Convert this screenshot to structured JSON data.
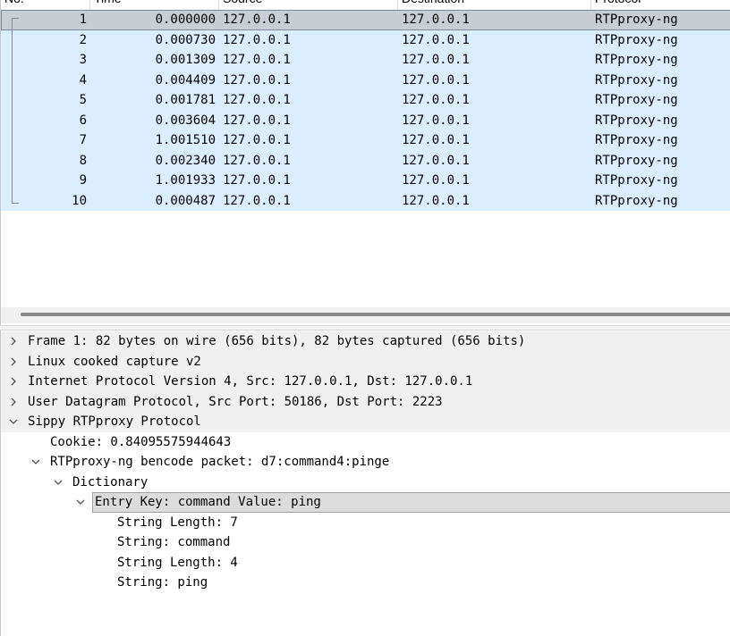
{
  "packet_list": {
    "columns": [
      "No.",
      "Time",
      "Source",
      "Destination",
      "Protocol"
    ],
    "rows": [
      {
        "no": "1",
        "time": "0.000000",
        "source": "127.0.0.1",
        "destination": "127.0.0.1",
        "protocol": "RTPproxy-ng"
      },
      {
        "no": "2",
        "time": "0.000730",
        "source": "127.0.0.1",
        "destination": "127.0.0.1",
        "protocol": "RTPproxy-ng"
      },
      {
        "no": "3",
        "time": "0.001309",
        "source": "127.0.0.1",
        "destination": "127.0.0.1",
        "protocol": "RTPproxy-ng"
      },
      {
        "no": "4",
        "time": "0.004409",
        "source": "127.0.0.1",
        "destination": "127.0.0.1",
        "protocol": "RTPproxy-ng"
      },
      {
        "no": "5",
        "time": "0.001781",
        "source": "127.0.0.1",
        "destination": "127.0.0.1",
        "protocol": "RTPproxy-ng"
      },
      {
        "no": "6",
        "time": "0.003604",
        "source": "127.0.0.1",
        "destination": "127.0.0.1",
        "protocol": "RTPproxy-ng"
      },
      {
        "no": "7",
        "time": "1.001510",
        "source": "127.0.0.1",
        "destination": "127.0.0.1",
        "protocol": "RTPproxy-ng"
      },
      {
        "no": "8",
        "time": "0.002340",
        "source": "127.0.0.1",
        "destination": "127.0.0.1",
        "protocol": "RTPproxy-ng"
      },
      {
        "no": "9",
        "time": "1.001933",
        "source": "127.0.0.1",
        "destination": "127.0.0.1",
        "protocol": "RTPproxy-ng"
      },
      {
        "no": "10",
        "time": "0.000487",
        "source": "127.0.0.1",
        "destination": "127.0.0.1",
        "protocol": "RTPproxy-ng"
      }
    ],
    "selected_row": "1",
    "colors": {
      "row_bg": "#dbeeff",
      "selected_bg": "#c9ced4"
    }
  },
  "details": {
    "frame": "Frame 1: 82 bytes on wire (656 bits), 82 bytes captured (656 bits)",
    "linux_cooked": "Linux cooked capture v2",
    "ipv4": "Internet Protocol Version 4, Src: 127.0.0.1, Dst: 127.0.0.1",
    "udp": "User Datagram Protocol, Src Port: 50186, Dst Port: 2223",
    "sippy": "Sippy RTPproxy Protocol",
    "cookie": "Cookie: 0.84095575944643",
    "bencode": "RTPproxy-ng bencode packet: d7:command4:pinge",
    "dictionary": "Dictionary",
    "entry": "Entry Key: command  Value: ping",
    "str_len_1": "String Length: 7",
    "str_1": "String: command",
    "str_len_2": "String Length: 4",
    "str_2": "String: ping"
  }
}
